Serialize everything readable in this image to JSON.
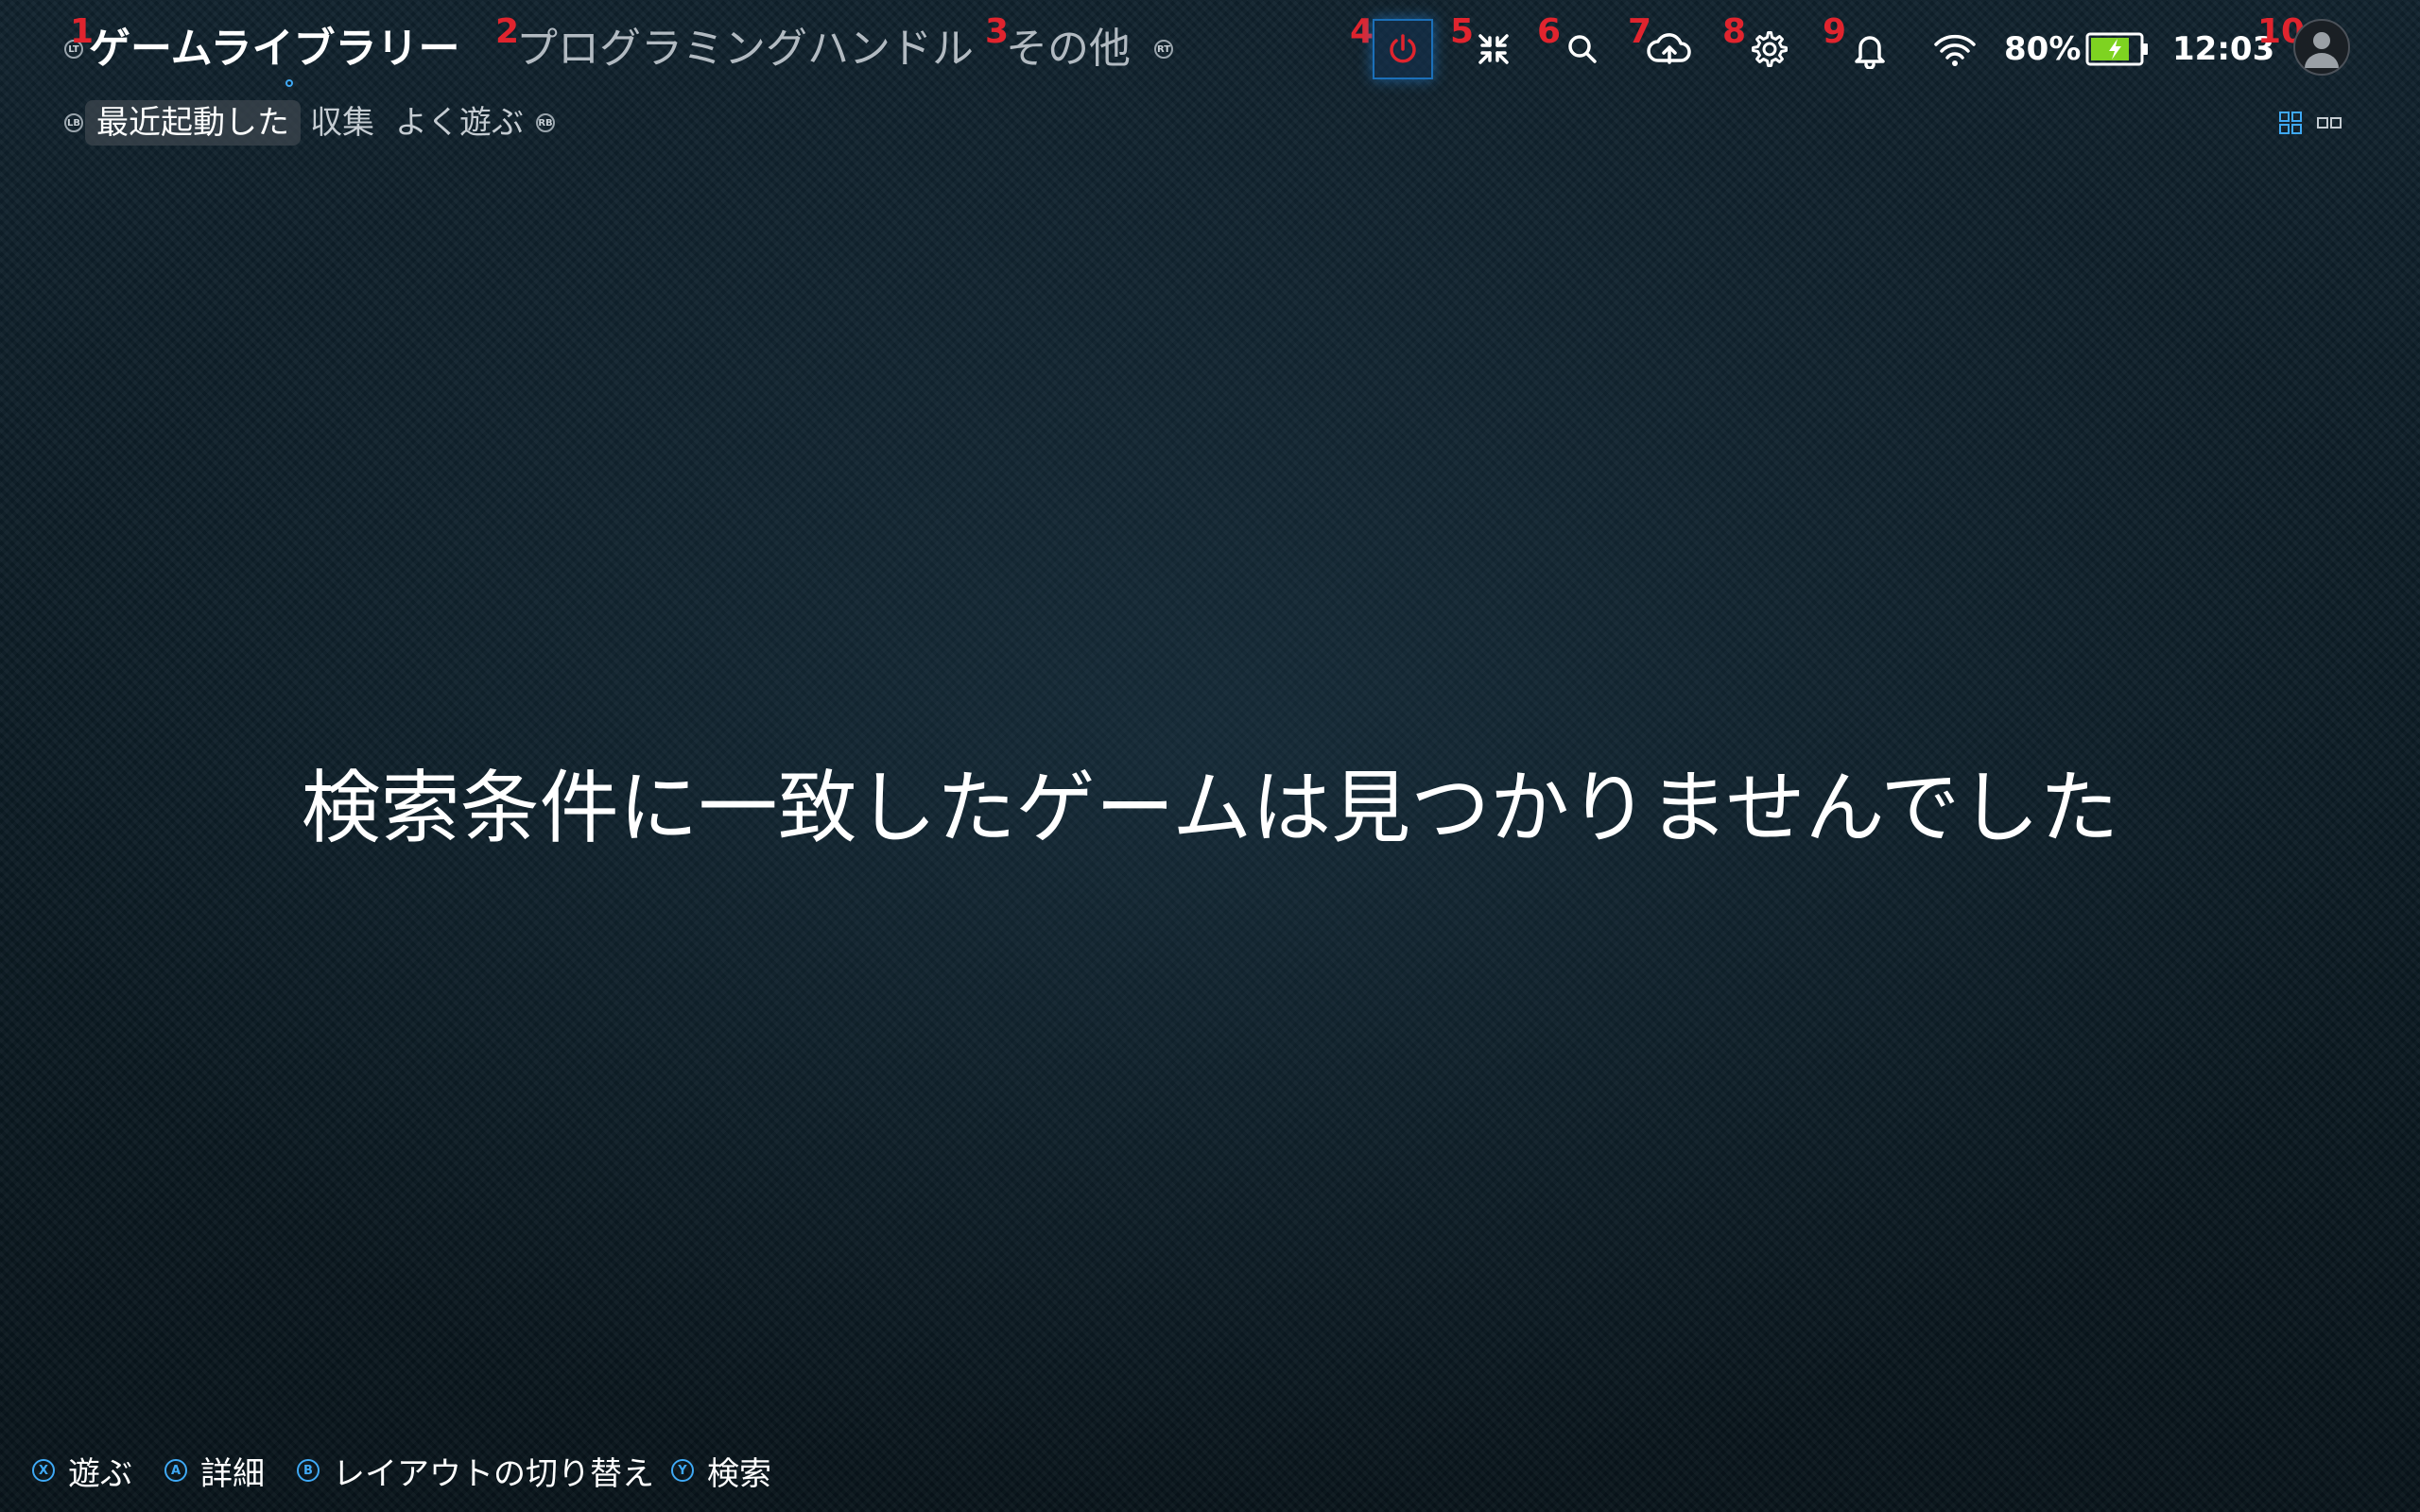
{
  "header": {
    "lt_badge": "LT",
    "rt_badge": "RT",
    "tabs": [
      {
        "label": "ゲームライブラリー",
        "marker": "1",
        "active": true
      },
      {
        "label": "プログラミングハンドル",
        "marker": "2",
        "active": false
      },
      {
        "label": "その他",
        "marker": "3",
        "active": false
      }
    ]
  },
  "subnav": {
    "lb_badge": "LB",
    "rb_badge": "RB",
    "tabs": [
      {
        "label": "最近起動した",
        "active": true
      },
      {
        "label": "収集",
        "active": false
      },
      {
        "label": "よく遊ぶ",
        "active": false
      }
    ]
  },
  "toolbar": {
    "markers": [
      "4",
      "5",
      "6",
      "7",
      "8",
      "9",
      "10"
    ],
    "icons": [
      "power-icon",
      "collapse-icon",
      "search-icon",
      "cloud-upload-icon",
      "gear-icon",
      "bell-icon",
      "avatar"
    ]
  },
  "status": {
    "battery_percent": "80%",
    "battery_level": 0.8,
    "time": "12:03"
  },
  "main": {
    "empty_message": "検索条件に一致したゲームは見つかりませんでした"
  },
  "footer": {
    "hints": [
      {
        "badge": "X",
        "label": "遊ぶ"
      },
      {
        "badge": "A",
        "label": "詳細"
      },
      {
        "badge": "B",
        "label": "レイアウトの切り替え"
      },
      {
        "badge": "Y",
        "label": "検索"
      }
    ]
  },
  "colors": {
    "accent": "#3fa9f5",
    "marker": "#e0242e",
    "battery": "#7ed321",
    "power": "#e0242e"
  }
}
